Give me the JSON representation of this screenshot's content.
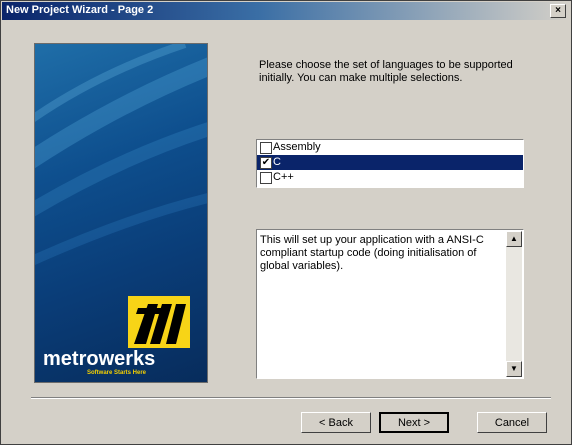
{
  "window": {
    "title": "New Project Wizard - Page 2",
    "close_glyph": "×"
  },
  "banner": {
    "brand": "metrowerks",
    "tagline": "Software Starts Here"
  },
  "prompt": "Please choose the set of languages to be supported initially. You can make multiple selections.",
  "languages": [
    {
      "label": "Assembly",
      "checked": false,
      "selected": false
    },
    {
      "label": "C",
      "checked": true,
      "selected": true
    },
    {
      "label": "C++",
      "checked": false,
      "selected": false
    }
  ],
  "description": "This will set up your application with a ANSI-C compliant startup code (doing initialisation of global variables).",
  "buttons": {
    "back": "< Back",
    "next": "Next >",
    "cancel": "Cancel"
  },
  "colors": {
    "title_bar": "#0a246a",
    "selection": "#0a246a",
    "logo": "#f7d417",
    "banner": "#0e4f8e"
  }
}
